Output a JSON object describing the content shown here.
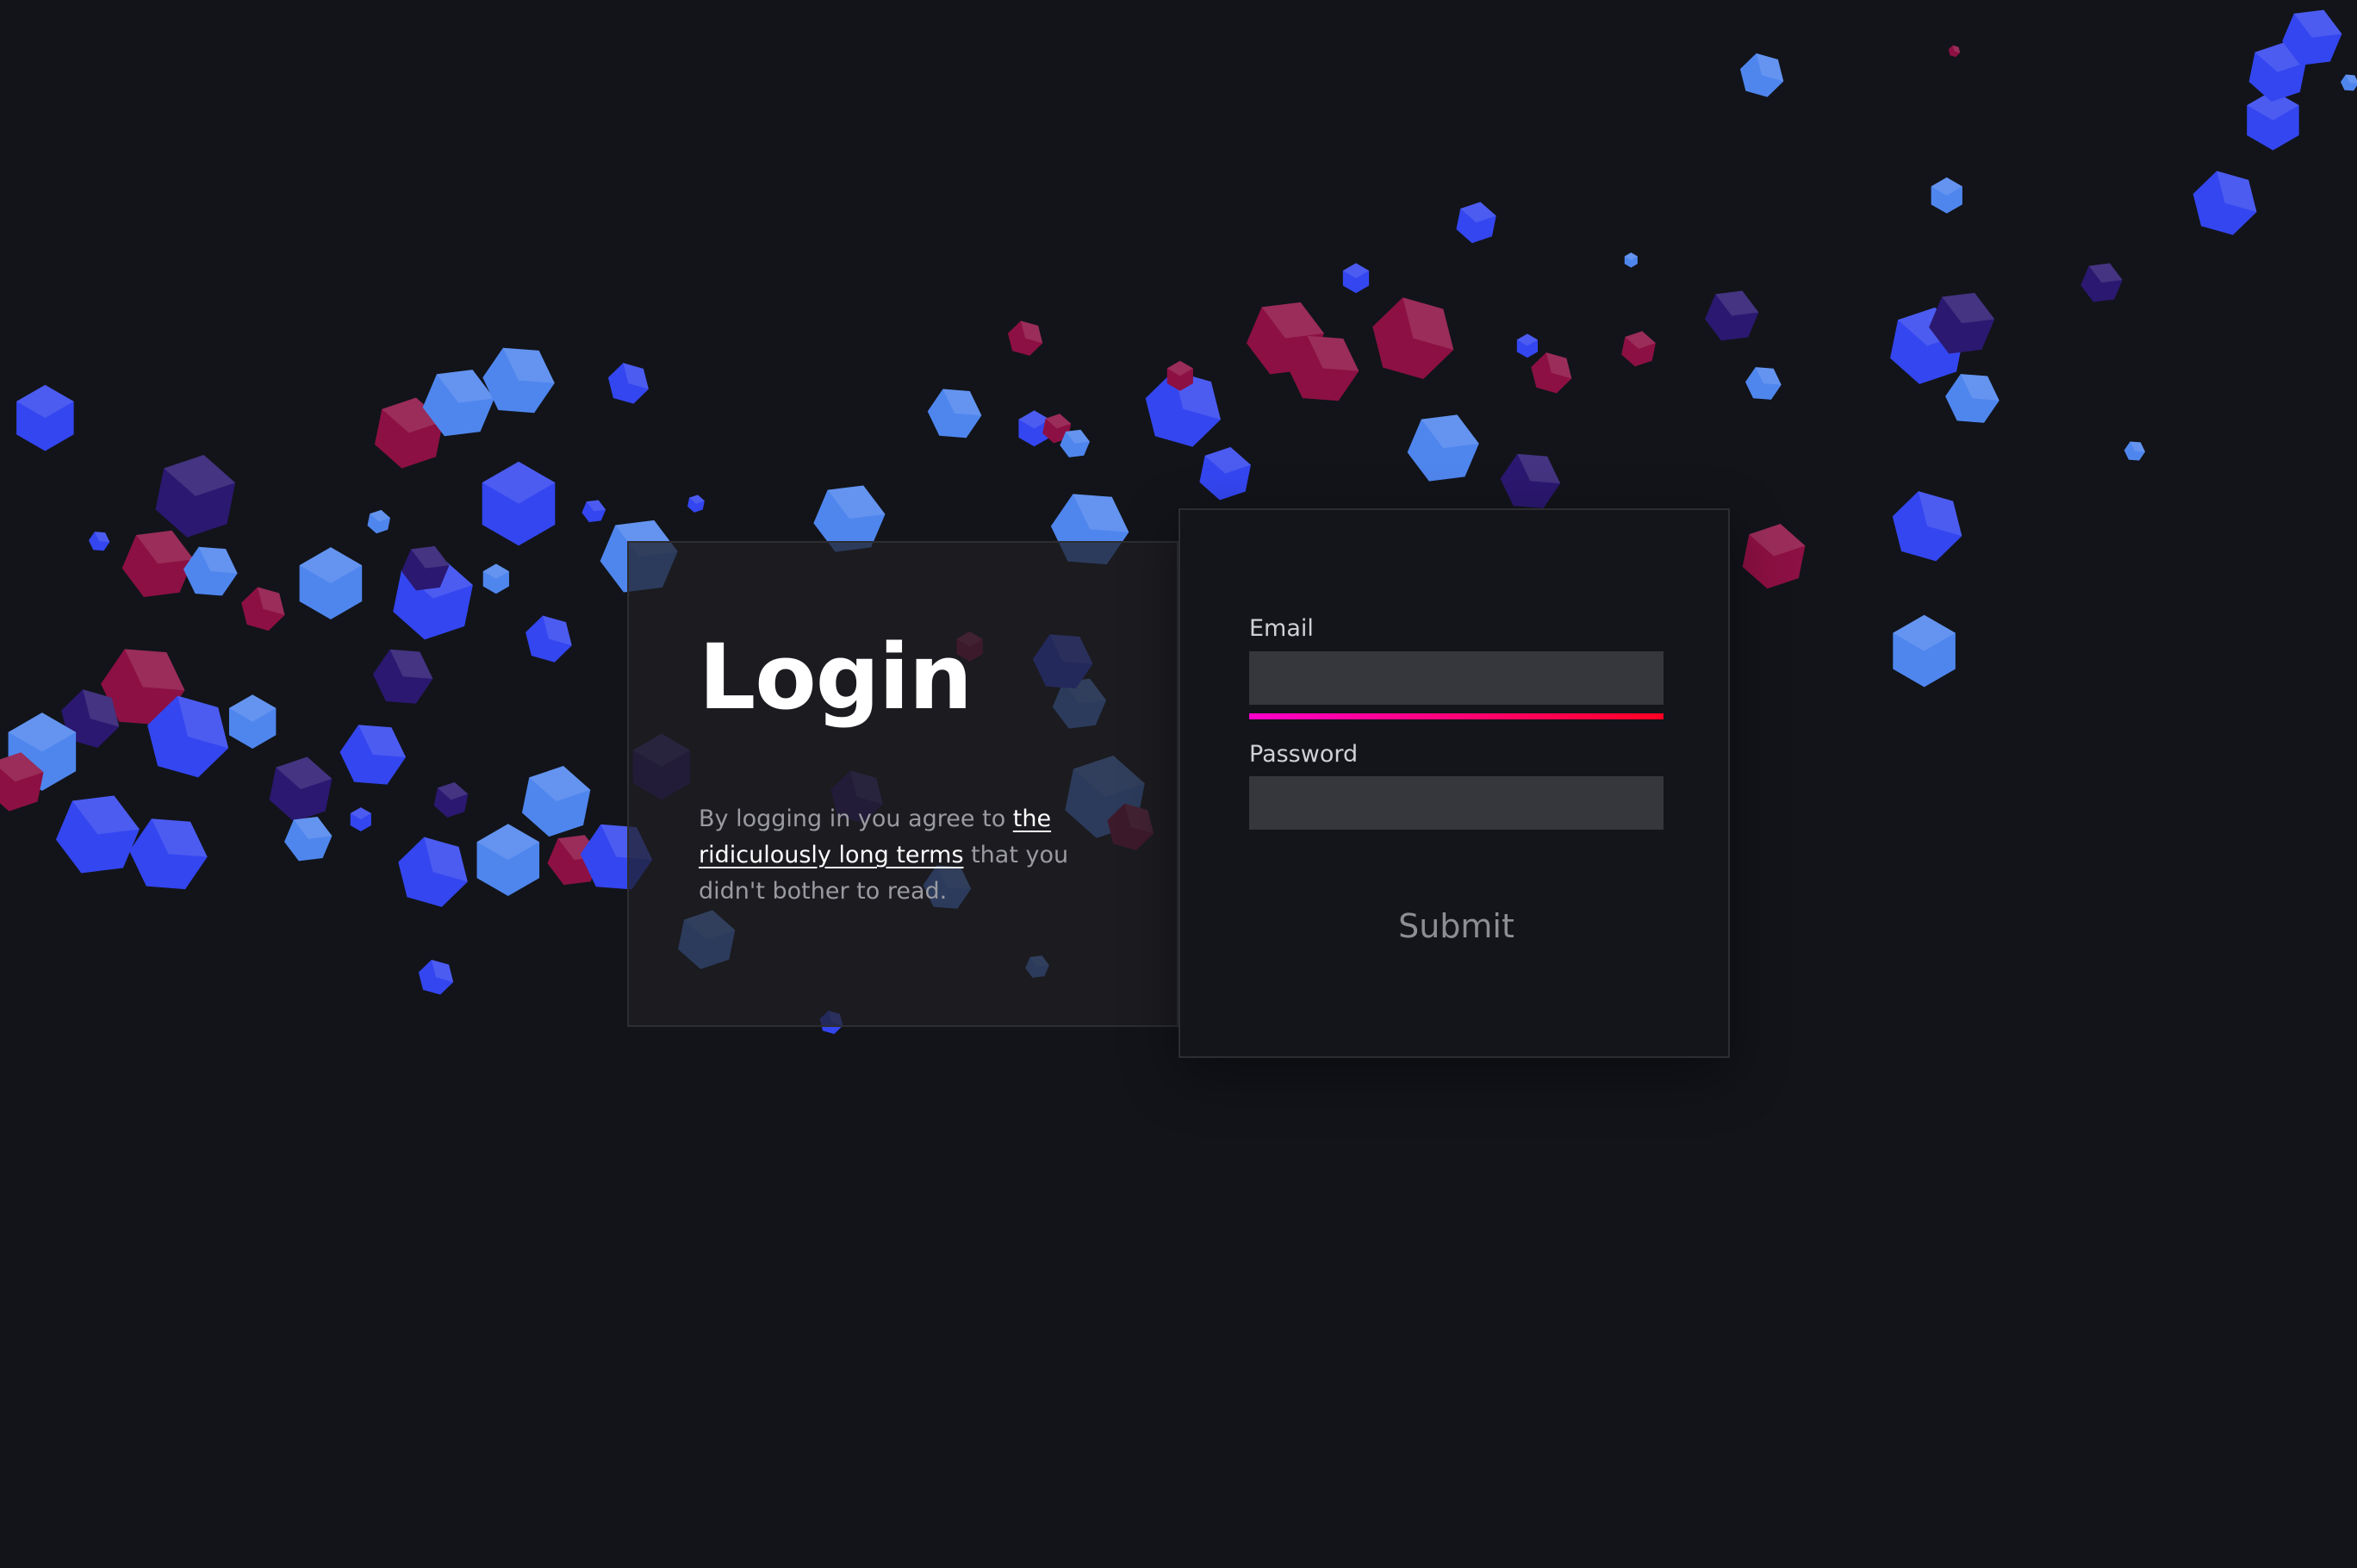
{
  "login": {
    "title": "Login",
    "terms_prefix": "By logging in you agree to ",
    "terms_link": "the ridiculously long terms",
    "terms_suffix": " that you didn't bother to read."
  },
  "form": {
    "email_label": "Email",
    "email_value": "",
    "password_label": "Password",
    "password_value": "",
    "submit_label": "Submit"
  },
  "colors": {
    "background": "#12141a",
    "focus_gradient_start": "#ff00cc",
    "focus_gradient_end": "#ff0022",
    "shape_blue": "#3446f0",
    "shape_light_blue": "#4f86ee",
    "shape_crimson": "#8c1043",
    "shape_purple": "#2b1870"
  }
}
